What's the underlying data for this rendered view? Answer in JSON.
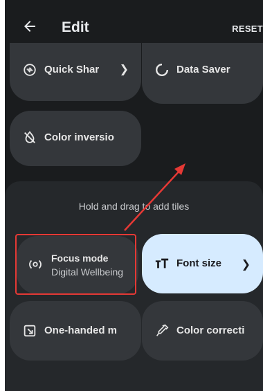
{
  "header": {
    "title": "Edit",
    "reset_label": "RESET"
  },
  "active_tiles": [
    {
      "label": "Quick Shar",
      "icon": "quick-share-icon",
      "has_chevron": true
    },
    {
      "label": "Data Saver",
      "icon": "data-saver-icon",
      "has_chevron": false
    },
    {
      "label": "Color inversio",
      "icon": "color-inversion-icon",
      "has_chevron": false
    }
  ],
  "add_panel": {
    "hint": "Hold and drag to add tiles",
    "tiles": [
      {
        "label": "Focus mode",
        "sublabel": "Digital Wellbeing",
        "icon": "focus-mode-icon"
      },
      {
        "label": "Font size",
        "icon": "font-size-icon",
        "has_chevron": true
      },
      {
        "label": "One-handed m",
        "icon": "one-handed-icon"
      },
      {
        "label": "Color correcti",
        "icon": "color-correction-icon"
      }
    ]
  },
  "colors": {
    "background": "#1a1c1e",
    "tile": "#34373b",
    "panel": "#25282b",
    "highlight_tile": "#d6ebff",
    "annotation": "#e53935"
  }
}
